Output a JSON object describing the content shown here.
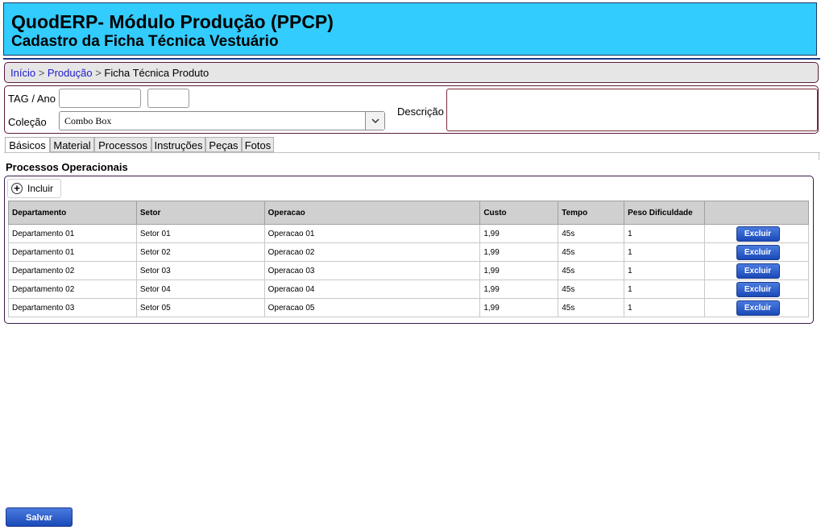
{
  "header": {
    "title": "QuodERP- Módulo Produção (PPCP)",
    "subtitle": "Cadastro da Ficha Técnica Vestuário"
  },
  "breadcrumb": {
    "home": "Início",
    "sep1": ">",
    "section": "Produção",
    "sep2": ">",
    "current": "Ficha Técnica Produto"
  },
  "form": {
    "tag_label": "TAG / Ano",
    "tag_value": "",
    "ano_value": "",
    "colecao_label": "Coleção",
    "colecao_value": "Combo Box",
    "descricao_label": "Descrição",
    "descricao_value": ""
  },
  "tabs": [
    "Básicos",
    "Material",
    "Processos",
    "Instruções",
    "Peças",
    "Fotos"
  ],
  "active_tab": "Básicos",
  "section": {
    "title": "Processos Operacionais",
    "add_label": "Incluir"
  },
  "table": {
    "headers": [
      "Departamento",
      "Setor",
      "Operacao",
      "Custo",
      "Tempo",
      "Peso Dificuldade",
      ""
    ],
    "rows": [
      [
        "Departamento 01",
        "Setor 01",
        "Operacao 01",
        "1,99",
        "45s",
        "1"
      ],
      [
        "Departamento 01",
        "Setor 02",
        "Operacao 02",
        "1,99",
        "45s",
        "1"
      ],
      [
        "Departamento 02",
        "Setor 03",
        "Operacao 03",
        "1,99",
        "45s",
        "1"
      ],
      [
        "Departamento 02",
        "Setor 04",
        "Operacao 04",
        "1,99",
        "45s",
        "1"
      ],
      [
        "Departamento 03",
        "Setor 05",
        "Operacao 05",
        "1,99",
        "45s",
        "1"
      ]
    ],
    "delete_label": "Excluir"
  },
  "footer": {
    "save_label": "Salvar"
  },
  "colors": {
    "header_bg": "#33ccff",
    "button_blue": "#1a4ab8"
  }
}
